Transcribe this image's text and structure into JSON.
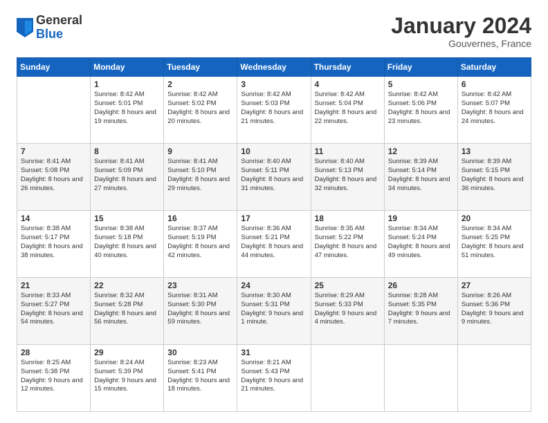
{
  "logo": {
    "general": "General",
    "blue": "Blue"
  },
  "header": {
    "month": "January 2024",
    "location": "Gouvernes, France"
  },
  "weekdays": [
    "Sunday",
    "Monday",
    "Tuesday",
    "Wednesday",
    "Thursday",
    "Friday",
    "Saturday"
  ],
  "weeks": [
    [
      {
        "day": "",
        "sunrise": "",
        "sunset": "",
        "daylight": ""
      },
      {
        "day": "1",
        "sunrise": "Sunrise: 8:42 AM",
        "sunset": "Sunset: 5:01 PM",
        "daylight": "Daylight: 8 hours and 19 minutes."
      },
      {
        "day": "2",
        "sunrise": "Sunrise: 8:42 AM",
        "sunset": "Sunset: 5:02 PM",
        "daylight": "Daylight: 8 hours and 20 minutes."
      },
      {
        "day": "3",
        "sunrise": "Sunrise: 8:42 AM",
        "sunset": "Sunset: 5:03 PM",
        "daylight": "Daylight: 8 hours and 21 minutes."
      },
      {
        "day": "4",
        "sunrise": "Sunrise: 8:42 AM",
        "sunset": "Sunset: 5:04 PM",
        "daylight": "Daylight: 8 hours and 22 minutes."
      },
      {
        "day": "5",
        "sunrise": "Sunrise: 8:42 AM",
        "sunset": "Sunset: 5:06 PM",
        "daylight": "Daylight: 8 hours and 23 minutes."
      },
      {
        "day": "6",
        "sunrise": "Sunrise: 8:42 AM",
        "sunset": "Sunset: 5:07 PM",
        "daylight": "Daylight: 8 hours and 24 minutes."
      }
    ],
    [
      {
        "day": "7",
        "sunrise": "Sunrise: 8:41 AM",
        "sunset": "Sunset: 5:08 PM",
        "daylight": "Daylight: 8 hours and 26 minutes."
      },
      {
        "day": "8",
        "sunrise": "Sunrise: 8:41 AM",
        "sunset": "Sunset: 5:09 PM",
        "daylight": "Daylight: 8 hours and 27 minutes."
      },
      {
        "day": "9",
        "sunrise": "Sunrise: 8:41 AM",
        "sunset": "Sunset: 5:10 PM",
        "daylight": "Daylight: 8 hours and 29 minutes."
      },
      {
        "day": "10",
        "sunrise": "Sunrise: 8:40 AM",
        "sunset": "Sunset: 5:11 PM",
        "daylight": "Daylight: 8 hours and 31 minutes."
      },
      {
        "day": "11",
        "sunrise": "Sunrise: 8:40 AM",
        "sunset": "Sunset: 5:13 PM",
        "daylight": "Daylight: 8 hours and 32 minutes."
      },
      {
        "day": "12",
        "sunrise": "Sunrise: 8:39 AM",
        "sunset": "Sunset: 5:14 PM",
        "daylight": "Daylight: 8 hours and 34 minutes."
      },
      {
        "day": "13",
        "sunrise": "Sunrise: 8:39 AM",
        "sunset": "Sunset: 5:15 PM",
        "daylight": "Daylight: 8 hours and 36 minutes."
      }
    ],
    [
      {
        "day": "14",
        "sunrise": "Sunrise: 8:38 AM",
        "sunset": "Sunset: 5:17 PM",
        "daylight": "Daylight: 8 hours and 38 minutes."
      },
      {
        "day": "15",
        "sunrise": "Sunrise: 8:38 AM",
        "sunset": "Sunset: 5:18 PM",
        "daylight": "Daylight: 8 hours and 40 minutes."
      },
      {
        "day": "16",
        "sunrise": "Sunrise: 8:37 AM",
        "sunset": "Sunset: 5:19 PM",
        "daylight": "Daylight: 8 hours and 42 minutes."
      },
      {
        "day": "17",
        "sunrise": "Sunrise: 8:36 AM",
        "sunset": "Sunset: 5:21 PM",
        "daylight": "Daylight: 8 hours and 44 minutes."
      },
      {
        "day": "18",
        "sunrise": "Sunrise: 8:35 AM",
        "sunset": "Sunset: 5:22 PM",
        "daylight": "Daylight: 8 hours and 47 minutes."
      },
      {
        "day": "19",
        "sunrise": "Sunrise: 8:34 AM",
        "sunset": "Sunset: 5:24 PM",
        "daylight": "Daylight: 8 hours and 49 minutes."
      },
      {
        "day": "20",
        "sunrise": "Sunrise: 8:34 AM",
        "sunset": "Sunset: 5:25 PM",
        "daylight": "Daylight: 8 hours and 51 minutes."
      }
    ],
    [
      {
        "day": "21",
        "sunrise": "Sunrise: 8:33 AM",
        "sunset": "Sunset: 5:27 PM",
        "daylight": "Daylight: 8 hours and 54 minutes."
      },
      {
        "day": "22",
        "sunrise": "Sunrise: 8:32 AM",
        "sunset": "Sunset: 5:28 PM",
        "daylight": "Daylight: 8 hours and 56 minutes."
      },
      {
        "day": "23",
        "sunrise": "Sunrise: 8:31 AM",
        "sunset": "Sunset: 5:30 PM",
        "daylight": "Daylight: 8 hours and 59 minutes."
      },
      {
        "day": "24",
        "sunrise": "Sunrise: 8:30 AM",
        "sunset": "Sunset: 5:31 PM",
        "daylight": "Daylight: 9 hours and 1 minute."
      },
      {
        "day": "25",
        "sunrise": "Sunrise: 8:29 AM",
        "sunset": "Sunset: 5:33 PM",
        "daylight": "Daylight: 9 hours and 4 minutes."
      },
      {
        "day": "26",
        "sunrise": "Sunrise: 8:28 AM",
        "sunset": "Sunset: 5:35 PM",
        "daylight": "Daylight: 9 hours and 7 minutes."
      },
      {
        "day": "27",
        "sunrise": "Sunrise: 8:26 AM",
        "sunset": "Sunset: 5:36 PM",
        "daylight": "Daylight: 9 hours and 9 minutes."
      }
    ],
    [
      {
        "day": "28",
        "sunrise": "Sunrise: 8:25 AM",
        "sunset": "Sunset: 5:38 PM",
        "daylight": "Daylight: 9 hours and 12 minutes."
      },
      {
        "day": "29",
        "sunrise": "Sunrise: 8:24 AM",
        "sunset": "Sunset: 5:39 PM",
        "daylight": "Daylight: 9 hours and 15 minutes."
      },
      {
        "day": "30",
        "sunrise": "Sunrise: 8:23 AM",
        "sunset": "Sunset: 5:41 PM",
        "daylight": "Daylight: 9 hours and 18 minutes."
      },
      {
        "day": "31",
        "sunrise": "Sunrise: 8:21 AM",
        "sunset": "Sunset: 5:43 PM",
        "daylight": "Daylight: 9 hours and 21 minutes."
      },
      {
        "day": "",
        "sunrise": "",
        "sunset": "",
        "daylight": ""
      },
      {
        "day": "",
        "sunrise": "",
        "sunset": "",
        "daylight": ""
      },
      {
        "day": "",
        "sunrise": "",
        "sunset": "",
        "daylight": ""
      }
    ]
  ]
}
